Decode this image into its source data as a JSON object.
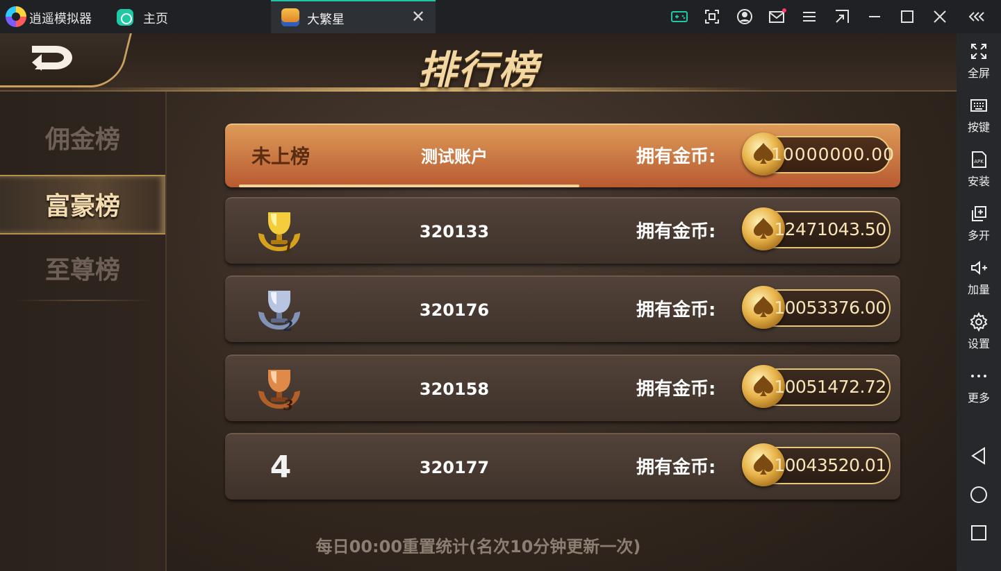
{
  "titlebar": {
    "app_name": "逍遥模拟器",
    "home_tab_label": "主页",
    "game_tab_label": "大繁星",
    "close_glyph": "✕",
    "icons": [
      "gamepad-icon",
      "screenshot-icon",
      "user-icon",
      "mail-icon",
      "menu-icon",
      "shrink-icon",
      "minimize-icon",
      "maximize-icon",
      "close-icon",
      "collapse-icon"
    ]
  },
  "sidebar": {
    "items": [
      {
        "label": "全屏",
        "icon": "fullscreen-icon"
      },
      {
        "label": "按键",
        "icon": "keyboard-icon"
      },
      {
        "label": "安装",
        "icon": "apk-icon"
      },
      {
        "label": "多开",
        "icon": "multi-instance-icon"
      },
      {
        "label": "加量",
        "icon": "volume-up-icon"
      },
      {
        "label": "设置",
        "icon": "gear-icon"
      },
      {
        "label": "更多",
        "icon": "more-icon"
      }
    ],
    "apk_text": "APK",
    "nav": [
      "back-icon",
      "home-circle-icon",
      "recent-square-icon"
    ]
  },
  "game": {
    "title": "排行榜",
    "categories": [
      {
        "label": "佣金榜",
        "active": false
      },
      {
        "label": "富豪榜",
        "active": true
      },
      {
        "label": "至尊榜",
        "active": false
      }
    ],
    "self_row": {
      "rank_label": "未上榜",
      "name": "测试账户",
      "coin_label": "拥有金币:",
      "coins": "10000000.00"
    },
    "rows": [
      {
        "rank": 1,
        "medal": "gold-medal-icon",
        "medal_digit": "1",
        "name": "320133",
        "coin_label": "拥有金币:",
        "coins": "12471043.50"
      },
      {
        "rank": 2,
        "medal": "silver-medal-icon",
        "medal_digit": "2",
        "name": "320176",
        "coin_label": "拥有金币:",
        "coins": "10053376.00"
      },
      {
        "rank": 3,
        "medal": "bronze-medal-icon",
        "medal_digit": "3",
        "name": "320158",
        "coin_label": "拥有金币:",
        "coins": "10051472.72"
      },
      {
        "rank": 4,
        "rank_text": "4",
        "name": "320177",
        "coin_label": "拥有金币:",
        "coins": "10043520.01"
      }
    ],
    "footer": "每日00:00重置统计(名次10分钟更新一次)",
    "colors": {
      "accent": "#f3d7a2",
      "self_row": "#c8703e",
      "coin_text": "#fbe6b8"
    }
  }
}
